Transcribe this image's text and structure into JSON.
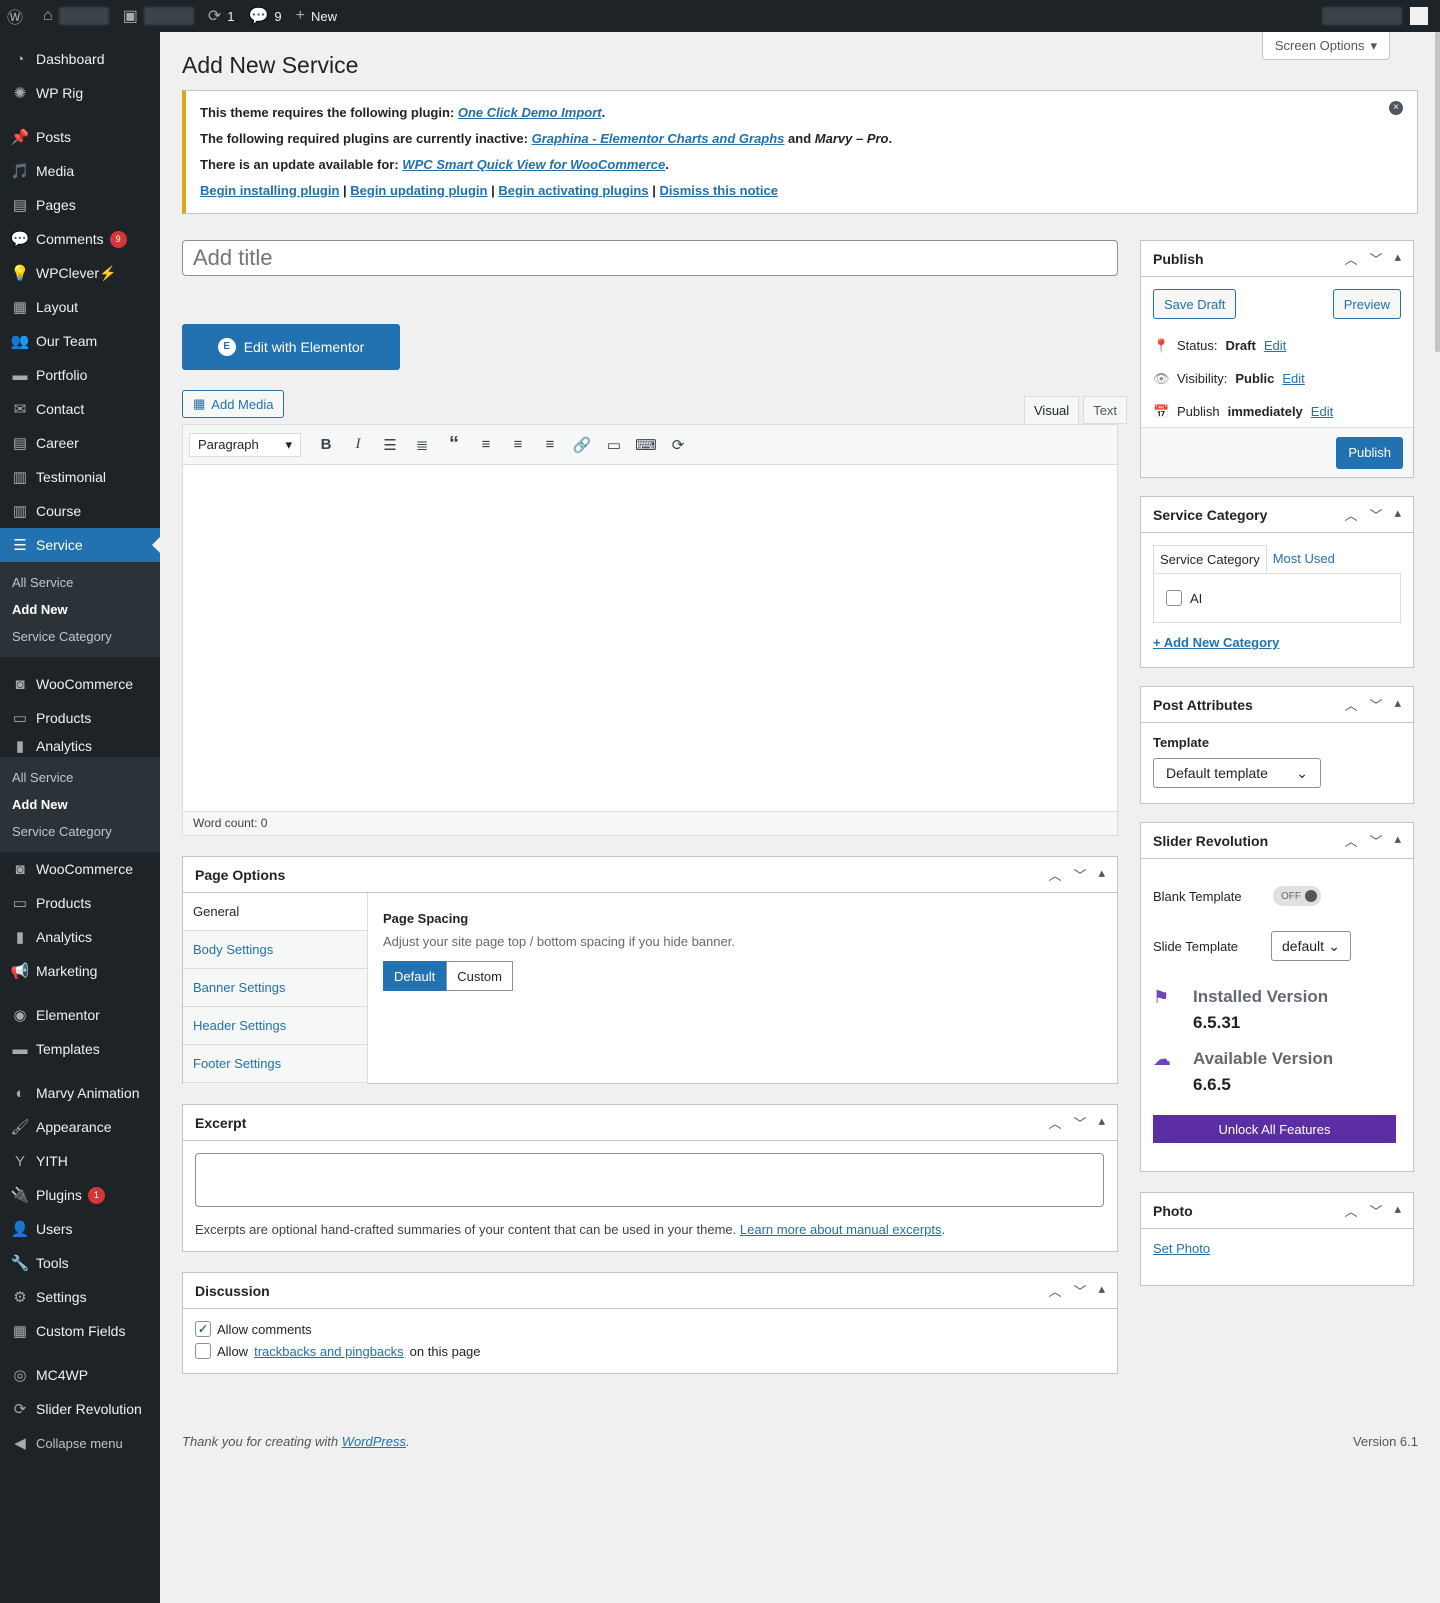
{
  "adminbar": {
    "updates_count": "1",
    "comments_count": "9",
    "new_label": "New"
  },
  "sidebar": {
    "items": [
      {
        "label": "Dashboard",
        "icon": "dashboard-icon"
      },
      {
        "label": "WP Rig",
        "icon": "rig-icon"
      },
      {
        "label": "Posts",
        "icon": "pin-icon"
      },
      {
        "label": "Media",
        "icon": "media-icon"
      },
      {
        "label": "Pages",
        "icon": "pages-icon"
      },
      {
        "label": "Comments",
        "icon": "comment-icon",
        "badge": "9"
      },
      {
        "label": "WPClever⚡",
        "icon": "bulb-icon"
      },
      {
        "label": "Layout",
        "icon": "layout-icon"
      },
      {
        "label": "Our Team",
        "icon": "team-icon"
      },
      {
        "label": "Portfolio",
        "icon": "folder-icon"
      },
      {
        "label": "Contact",
        "icon": "mail-icon"
      },
      {
        "label": "Career",
        "icon": "doc-icon"
      },
      {
        "label": "Testimonial",
        "icon": "chart-icon"
      },
      {
        "label": "Course",
        "icon": "chart-icon"
      },
      {
        "label": "Service",
        "icon": "service-icon"
      }
    ],
    "service_submenu": [
      "All Service",
      "Add New",
      "Service Category"
    ],
    "items_after": [
      {
        "label": "WooCommerce",
        "icon": "woo-icon"
      },
      {
        "label": "Products",
        "icon": "products-icon"
      },
      {
        "label": "Analytics",
        "icon": "analytics-icon"
      }
    ],
    "dup_submenu": [
      "All Service",
      "Add New",
      "Service Category"
    ],
    "items_tail": [
      {
        "label": "WooCommerce",
        "icon": "woo-icon"
      },
      {
        "label": "Products",
        "icon": "products-icon"
      },
      {
        "label": "Analytics",
        "icon": "analytics-icon"
      },
      {
        "label": "Marketing",
        "icon": "megaphone-icon"
      },
      {
        "label": "Elementor",
        "icon": "elementor-icon"
      },
      {
        "label": "Templates",
        "icon": "folder-icon"
      },
      {
        "label": "Marvy Animation",
        "icon": "marvy-icon"
      },
      {
        "label": "Appearance",
        "icon": "brush-icon"
      },
      {
        "label": "YITH",
        "icon": "yith-icon"
      },
      {
        "label": "Plugins",
        "icon": "plugin-icon",
        "badge": "1"
      },
      {
        "label": "Users",
        "icon": "user-icon"
      },
      {
        "label": "Tools",
        "icon": "wrench-icon"
      },
      {
        "label": "Settings",
        "icon": "settings-icon"
      },
      {
        "label": "Custom Fields",
        "icon": "grid-icon"
      },
      {
        "label": "MC4WP",
        "icon": "mc4wp-icon"
      },
      {
        "label": "Slider Revolution",
        "icon": "refresh-icon"
      },
      {
        "label": "Collapse menu",
        "icon": "collapse-icon"
      }
    ]
  },
  "screen_options": "Screen Options",
  "page_title": "Add New Service",
  "notice": {
    "line1_prefix": "This theme requires the following plugin:",
    "line1_link": "One Click Demo Import",
    "line2_prefix": "The following required plugins are currently inactive:",
    "line2_link": "Graphina - Elementor Charts and Graphs",
    "line2_and": "and",
    "line2_em": "Marvy – Pro",
    "line3_prefix": "There is an update available for:",
    "line3_link": "WPC Smart Quick View for WooCommerce",
    "actions": [
      "Begin installing plugin",
      "Begin updating plugin",
      "Begin activating plugins",
      "Dismiss this notice"
    ]
  },
  "editor": {
    "title_placeholder": "Add title",
    "elementor_button": "Edit with Elementor",
    "add_media": "Add Media",
    "tab_visual": "Visual",
    "tab_text": "Text",
    "format_select": "Paragraph",
    "word_count": "Word count: 0"
  },
  "page_options": {
    "title": "Page Options",
    "tabs": [
      "General",
      "Body Settings",
      "Banner Settings",
      "Header Settings",
      "Footer Settings"
    ],
    "heading": "Page Spacing",
    "desc": "Adjust your site page top / bottom spacing if you hide banner.",
    "opt_default": "Default",
    "opt_custom": "Custom"
  },
  "excerpt": {
    "title": "Excerpt",
    "hint": "Excerpts are optional hand-crafted summaries of your content that can be used in your theme.",
    "link": "Learn more about manual excerpts"
  },
  "discussion": {
    "title": "Discussion",
    "allow_comments": "Allow comments",
    "allow_prefix": "Allow",
    "trackbacks_link": "trackbacks and pingbacks",
    "allow_suffix": "on this page"
  },
  "publish": {
    "title": "Publish",
    "save_draft": "Save Draft",
    "preview": "Preview",
    "status_label": "Status:",
    "status_value": "Draft",
    "visibility_label": "Visibility:",
    "visibility_value": "Public",
    "publish_label": "Publish",
    "publish_value": "immediately",
    "edit": "Edit",
    "publish_button": "Publish"
  },
  "service_category": {
    "title": "Service Category",
    "tab_all": "Service Category",
    "tab_most": "Most Used",
    "items": [
      "AI"
    ],
    "add_new": "+ Add New Category"
  },
  "post_attributes": {
    "title": "Post Attributes",
    "template_label": "Template",
    "template_value": "Default template"
  },
  "slider_revolution": {
    "title": "Slider Revolution",
    "blank_label": "Blank Template",
    "toggle": "OFF",
    "slide_label": "Slide Template",
    "slide_value": "default",
    "installed_label": "Installed Version",
    "installed_value": "6.5.31",
    "available_label": "Available Version",
    "available_value": "6.6.5",
    "unlock": "Unlock All Features"
  },
  "photo": {
    "title": "Photo",
    "set_photo": "Set Photo"
  },
  "footer": {
    "thanks_prefix": "Thank you for creating with",
    "wp_link": "WordPress",
    "version": "Version 6.1"
  },
  "colors": {
    "accent": "#2271b1",
    "sidebar_bg": "#1d2327",
    "notice_border": "#dba617",
    "slider_purple": "#5c2ea3"
  }
}
